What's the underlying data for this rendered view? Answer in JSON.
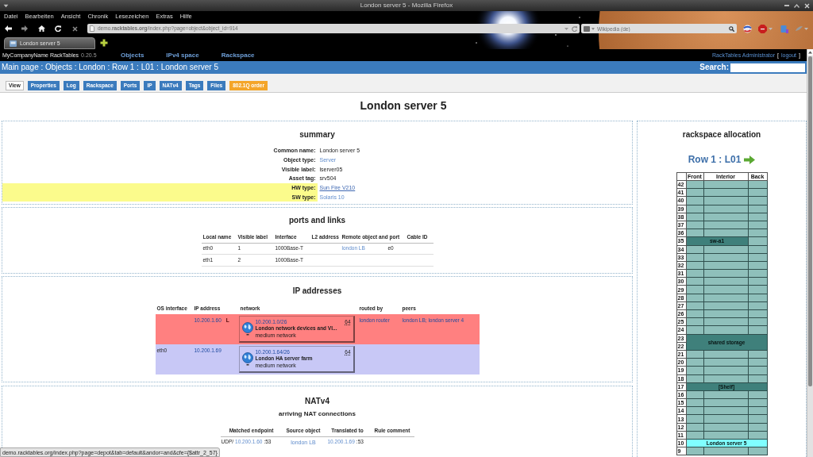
{
  "window": {
    "title": "London server 5 - Mozilla Firefox"
  },
  "menu_bar": [
    "Datei",
    "Bearbeiten",
    "Ansicht",
    "Chronik",
    "Lesezeichen",
    "Extras",
    "Hilfe"
  ],
  "address_bar": {
    "url": "demo.**racktables.org**/index.php?page=object&object_id=914"
  },
  "search_bar": {
    "placeholder": "Wikipedia (de)"
  },
  "browser_tabs": [
    {
      "label": "London server 5",
      "selected": true
    }
  ],
  "app_header": {
    "brand": "MyCompanyName RackTables",
    "version": "0.20.5",
    "menu": [
      "Objects",
      "IPv4 space",
      "Rackspace"
    ],
    "user": "RackTables Administrator",
    "bracket_open": "[",
    "logout": "logout",
    "bracket_close": "]"
  },
  "location_bar": {
    "breadcrumb": "Main page : Objects : London : Row 1 : L01 : London server 5",
    "search_label": "Search:"
  },
  "tabs": [
    {
      "label": "View",
      "selected": true,
      "highlighted": false
    },
    {
      "label": "Properties",
      "selected": false,
      "highlighted": false
    },
    {
      "label": "Log",
      "selected": false,
      "highlighted": false
    },
    {
      "label": "Rackspace",
      "selected": false,
      "highlighted": false
    },
    {
      "label": "Ports",
      "selected": false,
      "highlighted": false
    },
    {
      "label": "IP",
      "selected": false,
      "highlighted": false
    },
    {
      "label": "NATv4",
      "selected": false,
      "highlighted": false
    },
    {
      "label": "Tags",
      "selected": false,
      "highlighted": false
    },
    {
      "label": "Files",
      "selected": false,
      "highlighted": false
    },
    {
      "label": "802.1Q order",
      "selected": false,
      "highlighted": true
    }
  ],
  "page_title": "London server 5",
  "summary": {
    "title": "summary",
    "rows": [
      {
        "label": "Common name:",
        "value": "London server 5",
        "kind": "text",
        "highlighted": false
      },
      {
        "label": "Object type:",
        "value": "Server",
        "kind": "link",
        "highlighted": false
      },
      {
        "label": "Visible label:",
        "value": "lserver05",
        "kind": "text",
        "highlighted": false
      },
      {
        "label": "Asset tag:",
        "value": "srv504",
        "kind": "text",
        "highlighted": false
      },
      {
        "label": "HW type:",
        "value": "Sun Fire V210",
        "kind": "hovered-link",
        "highlighted": true
      },
      {
        "label": "SW type:",
        "value": "Solaris 10",
        "kind": "link",
        "highlighted": true
      }
    ]
  },
  "ports": {
    "title": "ports and links",
    "columns": [
      {
        "label": "Local name",
        "kind": "single"
      },
      {
        "label": "Visible label",
        "kind": "single"
      },
      {
        "label": "Interface",
        "kind": "single"
      },
      {
        "label": "L2 address",
        "kind": "single"
      },
      {
        "label": "Remote object and port",
        "kind": "pair"
      },
      {
        "label": "Cable ID",
        "kind": "single"
      }
    ],
    "rows": [
      {
        "local_name": "eth0",
        "visible_label": "1",
        "interface": "1000Base-T",
        "remote_object": "london LB",
        "remote_port": "e0"
      },
      {
        "local_name": "eth1",
        "visible_label": "2",
        "interface": "1000Base-T"
      }
    ]
  },
  "ip_addresses": {
    "title": "IP addresses",
    "columns": [
      "OS interface",
      "IP address",
      "network",
      "routed by",
      "peers"
    ],
    "rows": [
      {
        "color": "#ff8080",
        "address": "10.200.1.60",
        "flag": "L",
        "network": {
          "prefix": "10.200.1.0/26",
          "size": "64",
          "name": "London network devices and VI...",
          "tag": "medium network"
        },
        "routed_by": "london router",
        "peers": "london LB; london server 4"
      },
      {
        "color": "#c8c8f6",
        "os_interface": "eth0",
        "address": "10.200.1.69",
        "network": {
          "prefix": "10.200.1.64/26",
          "size": "64",
          "name": "London HA server farm",
          "tag": "medium network"
        }
      }
    ]
  },
  "nat": {
    "title": "NATv4",
    "subtitle": "arriving NAT connections",
    "columns": [
      "Matched endpoint",
      "Source object",
      "Translated to",
      "Rule comment"
    ],
    "rows": [
      {
        "matched": {
          "prefix": "UDP/",
          "address": "10.200.1.60",
          "suffix": ":53"
        },
        "source_object": "london LB",
        "translated": {
          "address": "10.200.1.69",
          "suffix": ":53"
        }
      }
    ]
  },
  "rack": {
    "title": "rackspace allocation",
    "name": "Row 1 : L01",
    "columns": [
      "Front",
      "Interior",
      "Back"
    ],
    "units": [
      {
        "number": "42",
        "kind": "free"
      },
      {
        "number": "41",
        "kind": "free"
      },
      {
        "number": "40",
        "kind": "free"
      },
      {
        "number": "39",
        "kind": "free"
      },
      {
        "number": "38",
        "kind": "free"
      },
      {
        "number": "37",
        "kind": "free"
      },
      {
        "number": "36",
        "kind": "free"
      },
      {
        "number": "35",
        "kind": "object",
        "object": {
          "label": "sw-a1",
          "front": true,
          "interior": true,
          "back": false,
          "selected": false
        }
      },
      {
        "number": "34",
        "kind": "free"
      },
      {
        "number": "33",
        "kind": "free"
      },
      {
        "number": "32",
        "kind": "free"
      },
      {
        "number": "31",
        "kind": "free"
      },
      {
        "number": "30",
        "kind": "free"
      },
      {
        "number": "29",
        "kind": "free"
      },
      {
        "number": "28",
        "kind": "free"
      },
      {
        "number": "27",
        "kind": "free"
      },
      {
        "number": "26",
        "kind": "free"
      },
      {
        "number": "25",
        "kind": "free"
      },
      {
        "number": "24",
        "kind": "free"
      },
      {
        "number": "23",
        "kind": "object",
        "object": {
          "label": "shared storage",
          "front": true,
          "interior": true,
          "back": true,
          "selected": false
        }
      },
      {
        "number": "22",
        "kind": "continuation"
      },
      {
        "number": "21",
        "kind": "free"
      },
      {
        "number": "20",
        "kind": "free"
      },
      {
        "number": "19",
        "kind": "free"
      },
      {
        "number": "18",
        "kind": "free"
      },
      {
        "number": "17",
        "kind": "object",
        "object": {
          "label": "[Shelf]",
          "front": true,
          "interior": true,
          "back": true,
          "selected": false
        }
      },
      {
        "number": "16",
        "kind": "free"
      },
      {
        "number": "15",
        "kind": "free"
      },
      {
        "number": "14",
        "kind": "free"
      },
      {
        "number": "13",
        "kind": "free"
      },
      {
        "number": "12",
        "kind": "free"
      },
      {
        "number": "11",
        "kind": "free"
      },
      {
        "number": "10",
        "kind": "object",
        "object": {
          "label": "London server 5",
          "front": true,
          "interior": true,
          "back": true,
          "selected": true
        }
      },
      {
        "number": "9",
        "kind": "free"
      }
    ]
  },
  "status_bar": "demo.racktables.org/index.php?page=depot&tab=default&andor=and&cfe={$attr_2_57}"
}
